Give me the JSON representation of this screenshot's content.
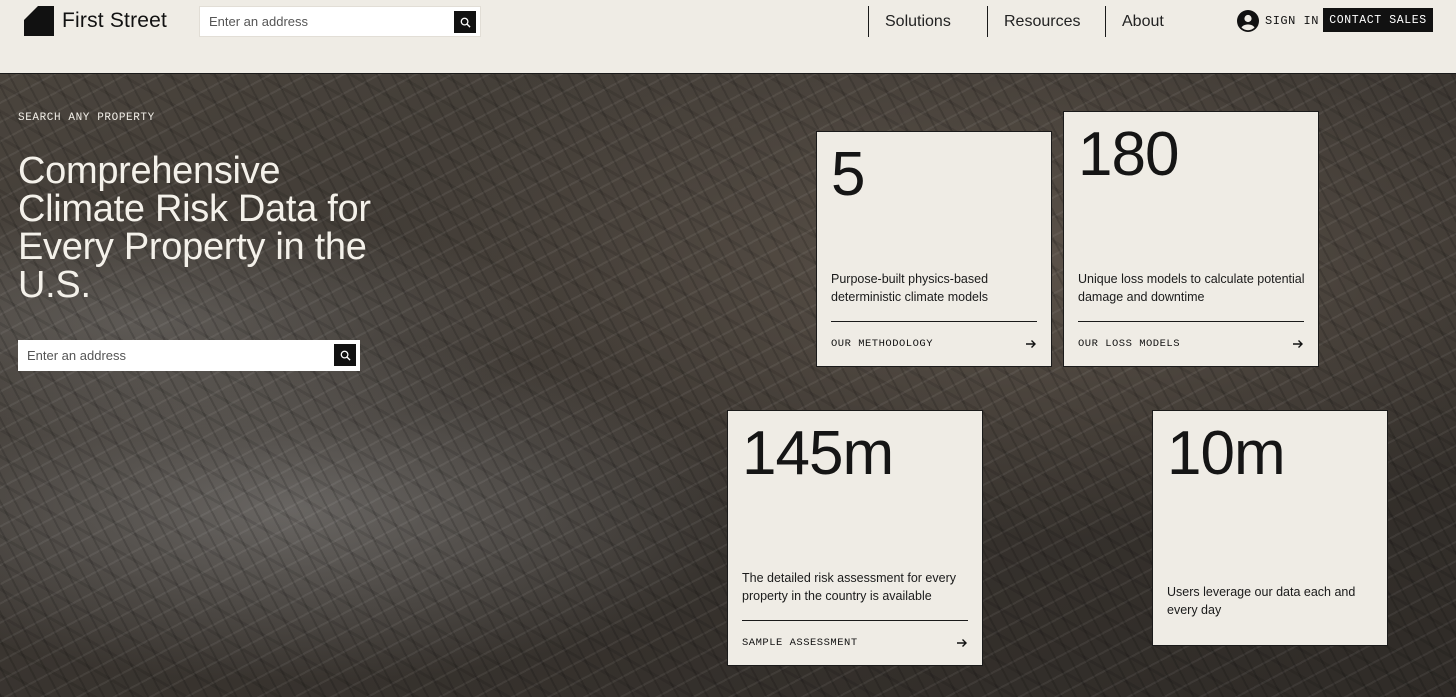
{
  "header": {
    "logo_text": "First Street",
    "search_placeholder": "Enter an address",
    "nav": [
      "Solutions",
      "Resources",
      "About"
    ],
    "sign_in": "SIGN IN",
    "contact_sales": "CONTACT SALES",
    "icons": {
      "search": "search-icon",
      "account": "account-circle-icon",
      "back": "arrow-left-icon",
      "forward": "arrow-right-icon"
    }
  },
  "hero": {
    "eyebrow": "SEARCH ANY PROPERTY",
    "headline": "Comprehensive Climate Risk Data for Every Property in the U.S.",
    "search_placeholder": "Enter an address"
  },
  "stats": [
    {
      "value": "5",
      "description": "Purpose-built physics-based deterministic climate models",
      "link": "OUR METHODOLOGY"
    },
    {
      "value": "180",
      "description": "Unique loss models to calculate potential damage and downtime",
      "link": "OUR LOSS MODELS"
    },
    {
      "value": "145m",
      "description": "The detailed risk assessment for every property in the country is available",
      "link": "SAMPLE ASSESSMENT"
    },
    {
      "value": "10m",
      "description": "Users leverage our data each and every day",
      "link": ""
    }
  ],
  "colors": {
    "background": "#efece5",
    "ink": "#111111",
    "hero_text": "#f4f1ea"
  }
}
